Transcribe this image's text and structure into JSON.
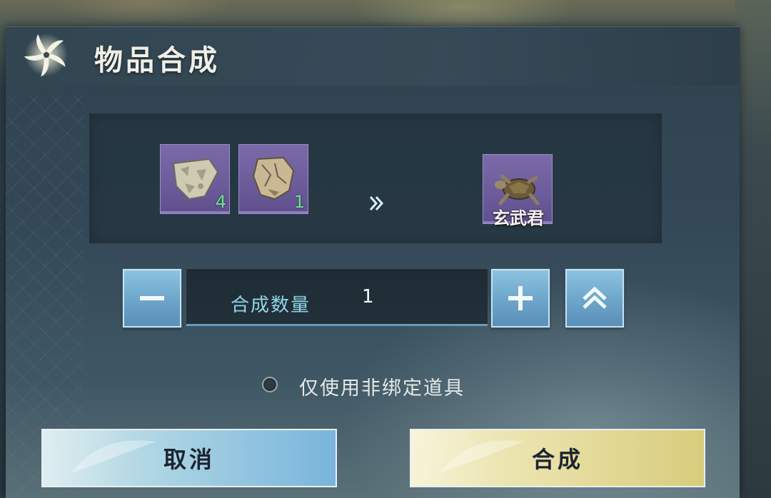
{
  "dialog": {
    "title": "物品合成",
    "emblem_icon": "pinwheel-emblem-icon"
  },
  "recipe": {
    "ingredients": [
      {
        "icon": "stone-shard-icon",
        "count": "4"
      },
      {
        "icon": "broken-tablet-icon",
        "count": "1"
      }
    ],
    "arrow_icon": "double-chevron-right-icon",
    "result": {
      "icon": "turtle-icon",
      "name": "玄武君"
    }
  },
  "quantity": {
    "label": "合成数量",
    "value": "1",
    "decrement_icon": "minus-icon",
    "increment_icon": "plus-icon",
    "max_icon": "double-chevron-up-icon"
  },
  "option": {
    "label": "仅使用非绑定道具",
    "checked": false
  },
  "buttons": {
    "cancel": "取消",
    "confirm": "合成"
  },
  "colors": {
    "count_green": "#6fe08a",
    "slot_purple": "#6c5b9a",
    "qty_label_cyan": "#8fd7e8"
  }
}
